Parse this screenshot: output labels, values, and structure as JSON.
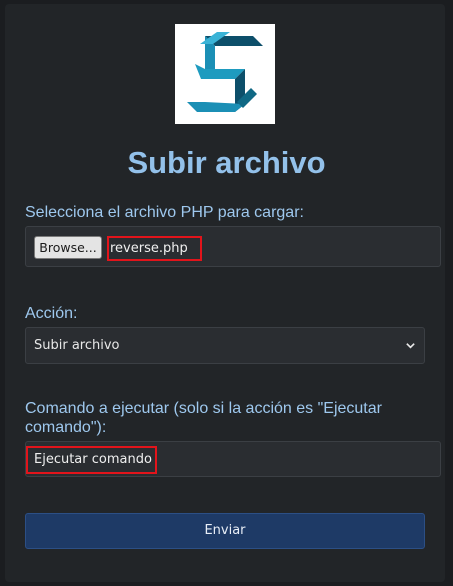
{
  "form": {
    "title": "Subir archivo",
    "file_label": "Selecciona el archivo PHP para cargar:",
    "browse_label": "Browse...",
    "selected_file": "reverse.php",
    "action_label": "Acción:",
    "action_value": "Subir archivo",
    "command_label": "Comando a ejecutar (solo si la acción es \"Ejecutar comando\"):",
    "command_value": "Ejecutar comando",
    "submit_label": "Enviar"
  },
  "icons": {
    "logo": "blue-s-logo",
    "select_arrow": "chevron-down-icon"
  },
  "colors": {
    "background": "#1b1d20",
    "card": "#222528",
    "title": "#93c1ea",
    "label": "#9ec8ee",
    "highlight": "#e2141b",
    "submit": "#1e3a66",
    "logo_primary": "#1e9bbf"
  }
}
